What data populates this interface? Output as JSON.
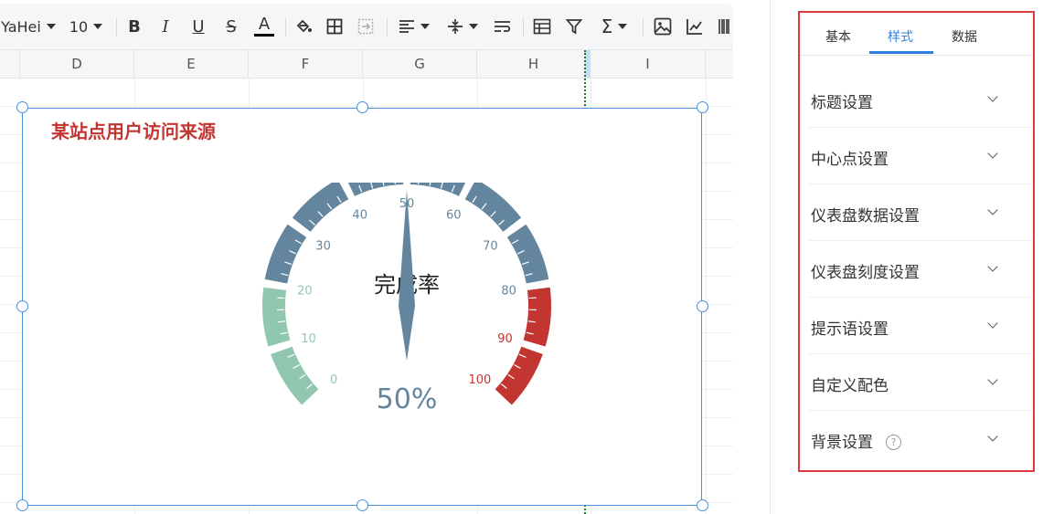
{
  "toolbar": {
    "font_name": "YaHei",
    "font_size": "10",
    "bold_glyph": "B",
    "italic_glyph": "I",
    "underline_glyph": "U",
    "strike_glyph": "S",
    "fontcolor_glyph": "A",
    "sum_glyph": "Σ",
    "font_color_underline": "#000000"
  },
  "columns": [
    "D",
    "E",
    "F",
    "G",
    "H",
    "I"
  ],
  "chart": {
    "title": "某站点用户访问来源",
    "title_color": "#c23531",
    "gauge": {
      "name": "完成率",
      "value": 50,
      "detail": "50%",
      "min": 0,
      "max": 100,
      "labels": [
        "0",
        "10",
        "20",
        "30",
        "40",
        "50",
        "60",
        "70",
        "80",
        "90",
        "100"
      ],
      "color_bands": [
        {
          "to": 0.2,
          "color": "#91c7ae"
        },
        {
          "to": 0.8,
          "color": "#63869e"
        },
        {
          "to": 1.0,
          "color": "#c23531"
        }
      ]
    }
  },
  "panel": {
    "tabs": [
      "基本",
      "样式",
      "数据"
    ],
    "active_tab": "样式",
    "accent": "#2f7fe0",
    "border_color": "#e0393e",
    "sections": [
      {
        "label": "标题设置"
      },
      {
        "label": "中心点设置"
      },
      {
        "label": "仪表盘数据设置"
      },
      {
        "label": "仪表盘刻度设置"
      },
      {
        "label": "提示语设置"
      },
      {
        "label": "自定义配色"
      },
      {
        "label": "背景设置",
        "help": "?"
      }
    ]
  }
}
